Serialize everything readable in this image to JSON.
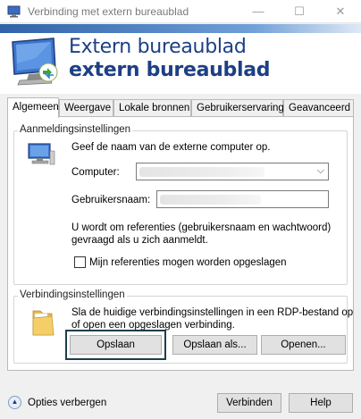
{
  "window": {
    "title": "Verbinding met extern bureaublad",
    "minimize": "—",
    "maximize": "☐",
    "close": "✕"
  },
  "banner": {
    "line1": "Extern bureaublad",
    "line2": "extern bureaublad"
  },
  "tabs": [
    "Algemeen",
    "Weergave",
    "Lokale bronnen",
    "Gebruikerservaring",
    "Geavanceerd"
  ],
  "login_group": {
    "label": "Aanmeldingsinstellingen",
    "instruction": "Geef de naam van de externe computer op.",
    "computer_label": "Computer:",
    "username_label": "Gebruikersnaam:",
    "info_line1": "U wordt om referenties (gebruikersnaam en wachtwoord)",
    "info_line2": "gevraagd als u zich aanmeldt.",
    "save_credentials_label": "Mijn referenties mogen worden opgeslagen"
  },
  "connection_group": {
    "label": "Verbindingsinstellingen",
    "desc_line1": "Sla de huidige verbindingsinstellingen in een RDP-bestand op",
    "desc_line2": "of open een opgeslagen verbinding.",
    "save_label": "Opslaan",
    "save_as_label": "Opslaan als...",
    "open_label": "Openen..."
  },
  "footer": {
    "options_label": "Opties verbergen",
    "connect_label": "Verbinden",
    "help_label": "Help"
  }
}
